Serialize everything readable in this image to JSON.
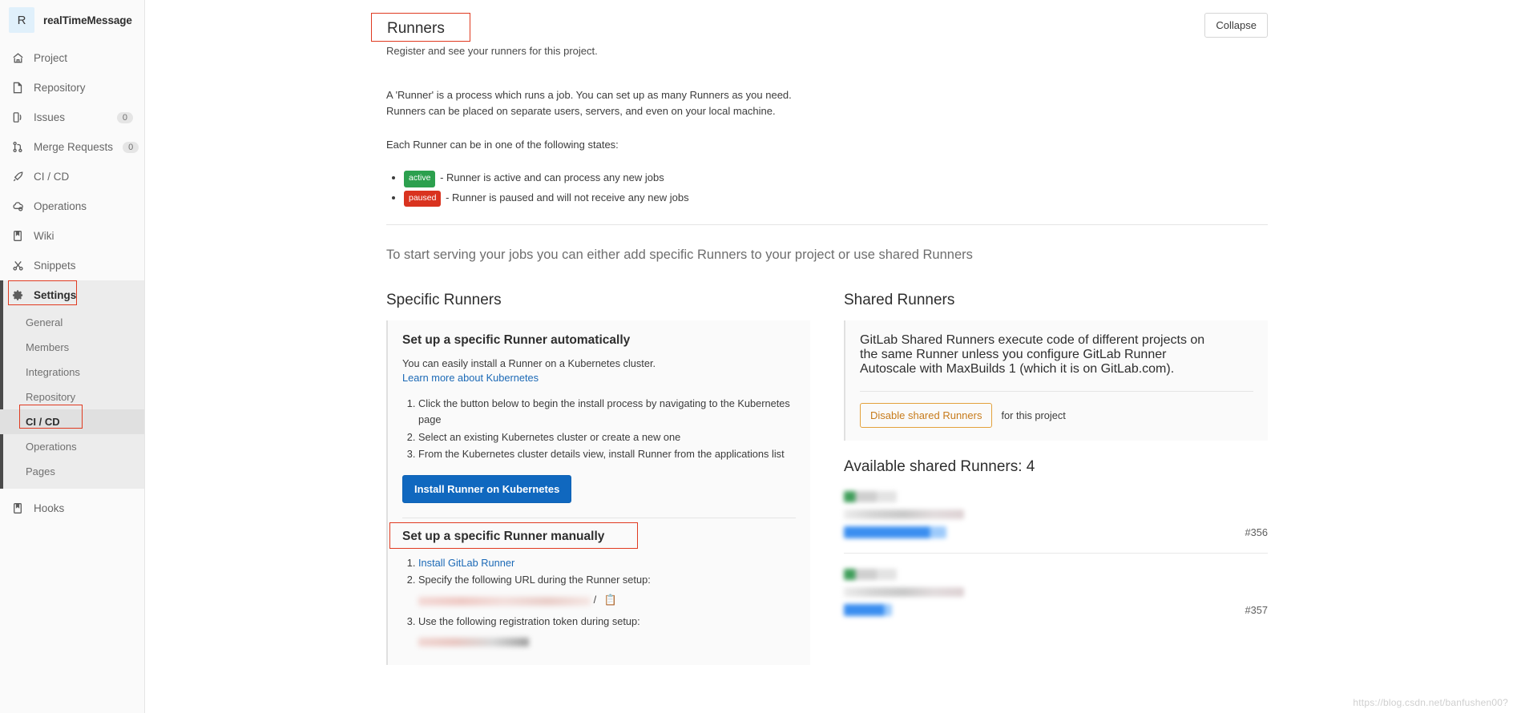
{
  "sidebar": {
    "project": {
      "initial": "R",
      "name": "realTimeMessage"
    },
    "items": [
      {
        "label": "Project",
        "icon": "home-icon",
        "count": null
      },
      {
        "label": "Repository",
        "icon": "document-icon",
        "count": null
      },
      {
        "label": "Issues",
        "icon": "issues-icon",
        "count": "0"
      },
      {
        "label": "Merge Requests",
        "icon": "merge-request-icon",
        "count": "0"
      },
      {
        "label": "CI / CD",
        "icon": "rocket-icon",
        "count": null
      },
      {
        "label": "Operations",
        "icon": "cloud-gear-icon",
        "count": null
      },
      {
        "label": "Wiki",
        "icon": "book-icon",
        "count": null
      },
      {
        "label": "Snippets",
        "icon": "scissors-icon",
        "count": null
      },
      {
        "label": "Settings",
        "icon": "gear-icon",
        "count": null
      }
    ],
    "settings_subitems": [
      {
        "label": "General"
      },
      {
        "label": "Members"
      },
      {
        "label": "Integrations"
      },
      {
        "label": "Repository"
      },
      {
        "label": "CI / CD"
      },
      {
        "label": "Operations"
      },
      {
        "label": "Pages"
      }
    ],
    "hooks": {
      "label": "Hooks",
      "icon": "book-icon"
    }
  },
  "header": {
    "title": "Runners",
    "subtitle": "Register and see your runners for this project.",
    "collapse_label": "Collapse"
  },
  "intro": {
    "paragraph1_line1": "A 'Runner' is a process which runs a job. You can set up as many Runners as you need.",
    "paragraph1_line2": "Runners can be placed on separate users, servers, and even on your local machine.",
    "paragraph2": "Each Runner can be in one of the following states:",
    "states": [
      {
        "badge": "active",
        "color": "#2ca04e",
        "text": "- Runner is active and can process any new jobs"
      },
      {
        "badge": "paused",
        "color": "#d9331f",
        "text": "- Runner is paused and will not receive any new jobs"
      }
    ],
    "lead": "To start serving your jobs you can either add specific Runners to your project or use shared Runners"
  },
  "specific": {
    "column_title": "Specific Runners",
    "auto": {
      "heading": "Set up a specific Runner automatically",
      "description": "You can easily install a Runner on a Kubernetes cluster.",
      "link": "Learn more about Kubernetes",
      "steps": [
        "Click the button below to begin the install process by navigating to the Kubernetes page",
        "Select an existing Kubernetes cluster or create a new one",
        "From the Kubernetes cluster details view, install Runner from the applications list"
      ],
      "button": "Install Runner on Kubernetes"
    },
    "manual": {
      "heading": "Set up a specific Runner manually",
      "step1_link": "Install GitLab Runner",
      "step2": "Specify the following URL during the Runner setup:",
      "step2_value_redacted": true,
      "step2_slash": "/",
      "copy_icon": "copy-icon",
      "step3": "Use the following registration token during setup:",
      "step3_value_redacted": true
    }
  },
  "shared": {
    "column_title": "Shared Runners",
    "description_line1": "GitLab Shared Runners execute code of different projects on",
    "description_line2": "the same Runner unless you configure GitLab Runner",
    "description_line3": "Autoscale with MaxBuilds 1 (which it is on GitLab.com).",
    "disable_button": "Disable shared Runners",
    "disable_suffix": "for this project",
    "available_title": "Available shared Runners: 4",
    "runners": [
      {
        "id": "#356",
        "status_redacted": true,
        "description_redacted": true,
        "tags_redacted": true
      },
      {
        "id": "#357",
        "status_redacted": true,
        "description_redacted": true,
        "tags_redacted": true
      }
    ]
  },
  "watermark": "https://blog.csdn.net/banfushen00?",
  "colors": {
    "accent_blue": "#1068bf",
    "link_blue": "#1b69b6",
    "status_active": "#2ca04e",
    "status_paused": "#d9331f",
    "warn_orange": "#c77b1b",
    "highlight_red": "#e03a20"
  }
}
